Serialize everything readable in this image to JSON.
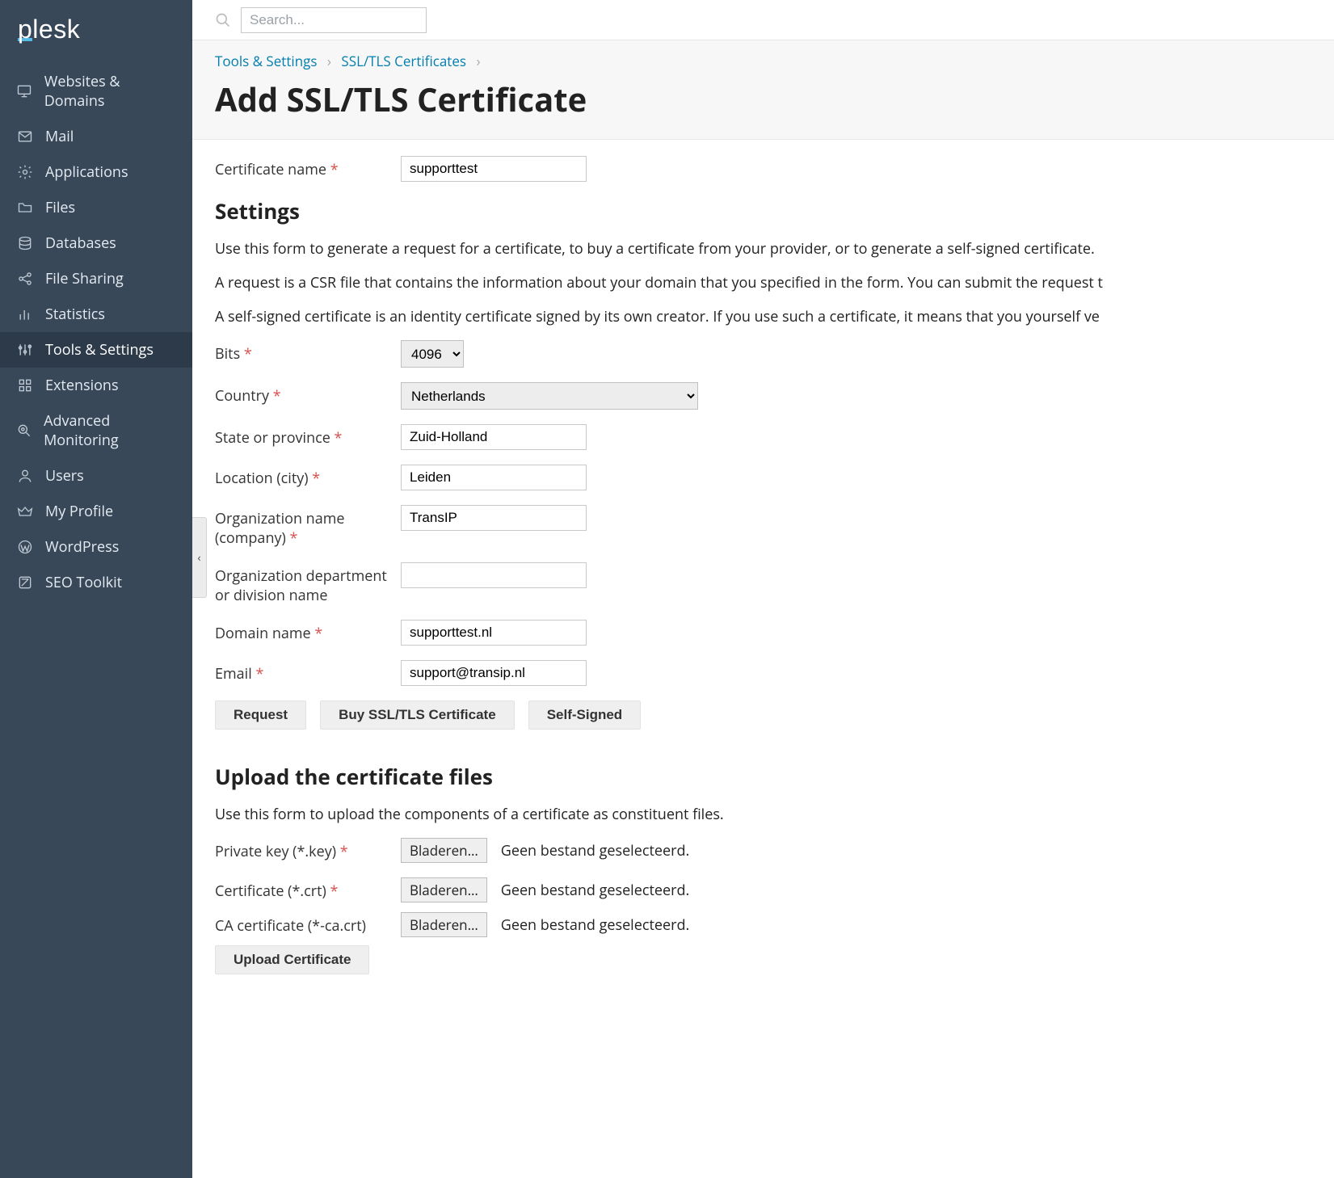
{
  "logo": "plesk",
  "search": {
    "placeholder": "Search..."
  },
  "sidebar": {
    "items": [
      {
        "label": "Websites & Domains",
        "icon": "monitor"
      },
      {
        "label": "Mail",
        "icon": "mail"
      },
      {
        "label": "Applications",
        "icon": "gear"
      },
      {
        "label": "Files",
        "icon": "folder"
      },
      {
        "label": "Databases",
        "icon": "stack"
      },
      {
        "label": "File Sharing",
        "icon": "share"
      },
      {
        "label": "Statistics",
        "icon": "bars"
      },
      {
        "label": "Tools & Settings",
        "icon": "sliders"
      },
      {
        "label": "Extensions",
        "icon": "grid"
      },
      {
        "label": "Advanced Monitoring",
        "icon": "magnify"
      },
      {
        "label": "Users",
        "icon": "user"
      },
      {
        "label": "My Profile",
        "icon": "crown"
      },
      {
        "label": "WordPress",
        "icon": "wp"
      },
      {
        "label": "SEO Toolkit",
        "icon": "seo"
      }
    ],
    "activeIndex": 7
  },
  "breadcrumbs": [
    {
      "label": "Tools & Settings"
    },
    {
      "label": "SSL/TLS Certificates"
    }
  ],
  "pageTitle": "Add SSL/TLS Certificate",
  "form": {
    "certNameLabel": "Certificate name",
    "certNameValue": "supporttest",
    "settingsHeading": "Settings",
    "desc1": "Use this form to generate a request for a certificate, to buy a certificate from your provider, or to generate a self-signed certificate.",
    "desc2": "A request is a CSR file that contains the information about your domain that you specified in the form. You can submit the request t",
    "desc3": "A self-signed certificate is an identity certificate signed by its own creator. If you use such a certificate, it means that you yourself ve",
    "bitsLabel": "Bits",
    "bitsValue": "4096",
    "countryLabel": "Country",
    "countryValue": "Netherlands",
    "stateLabel": "State or province",
    "stateValue": "Zuid-Holland",
    "cityLabel": "Location (city)",
    "cityValue": "Leiden",
    "orgLabel": "Organization name (company)",
    "orgValue": "TransIP",
    "deptLabel": "Organization department or division name",
    "deptValue": "",
    "domainLabel": "Domain name",
    "domainValue": "supporttest.nl",
    "emailLabel": "Email",
    "emailValue": "support@transip.nl",
    "btnRequest": "Request",
    "btnBuy": "Buy SSL/TLS Certificate",
    "btnSelf": "Self-Signed"
  },
  "upload": {
    "heading": "Upload the certificate files",
    "desc": "Use this form to upload the components of a certificate as constituent files.",
    "browseLabel": "Bladeren…",
    "noFile": "Geen bestand geselecteerd.",
    "keyLabel": "Private key (*.key)",
    "crtLabel": "Certificate (*.crt)",
    "caLabel": "CA certificate (*-ca.crt)",
    "btnUpload": "Upload Certificate"
  }
}
